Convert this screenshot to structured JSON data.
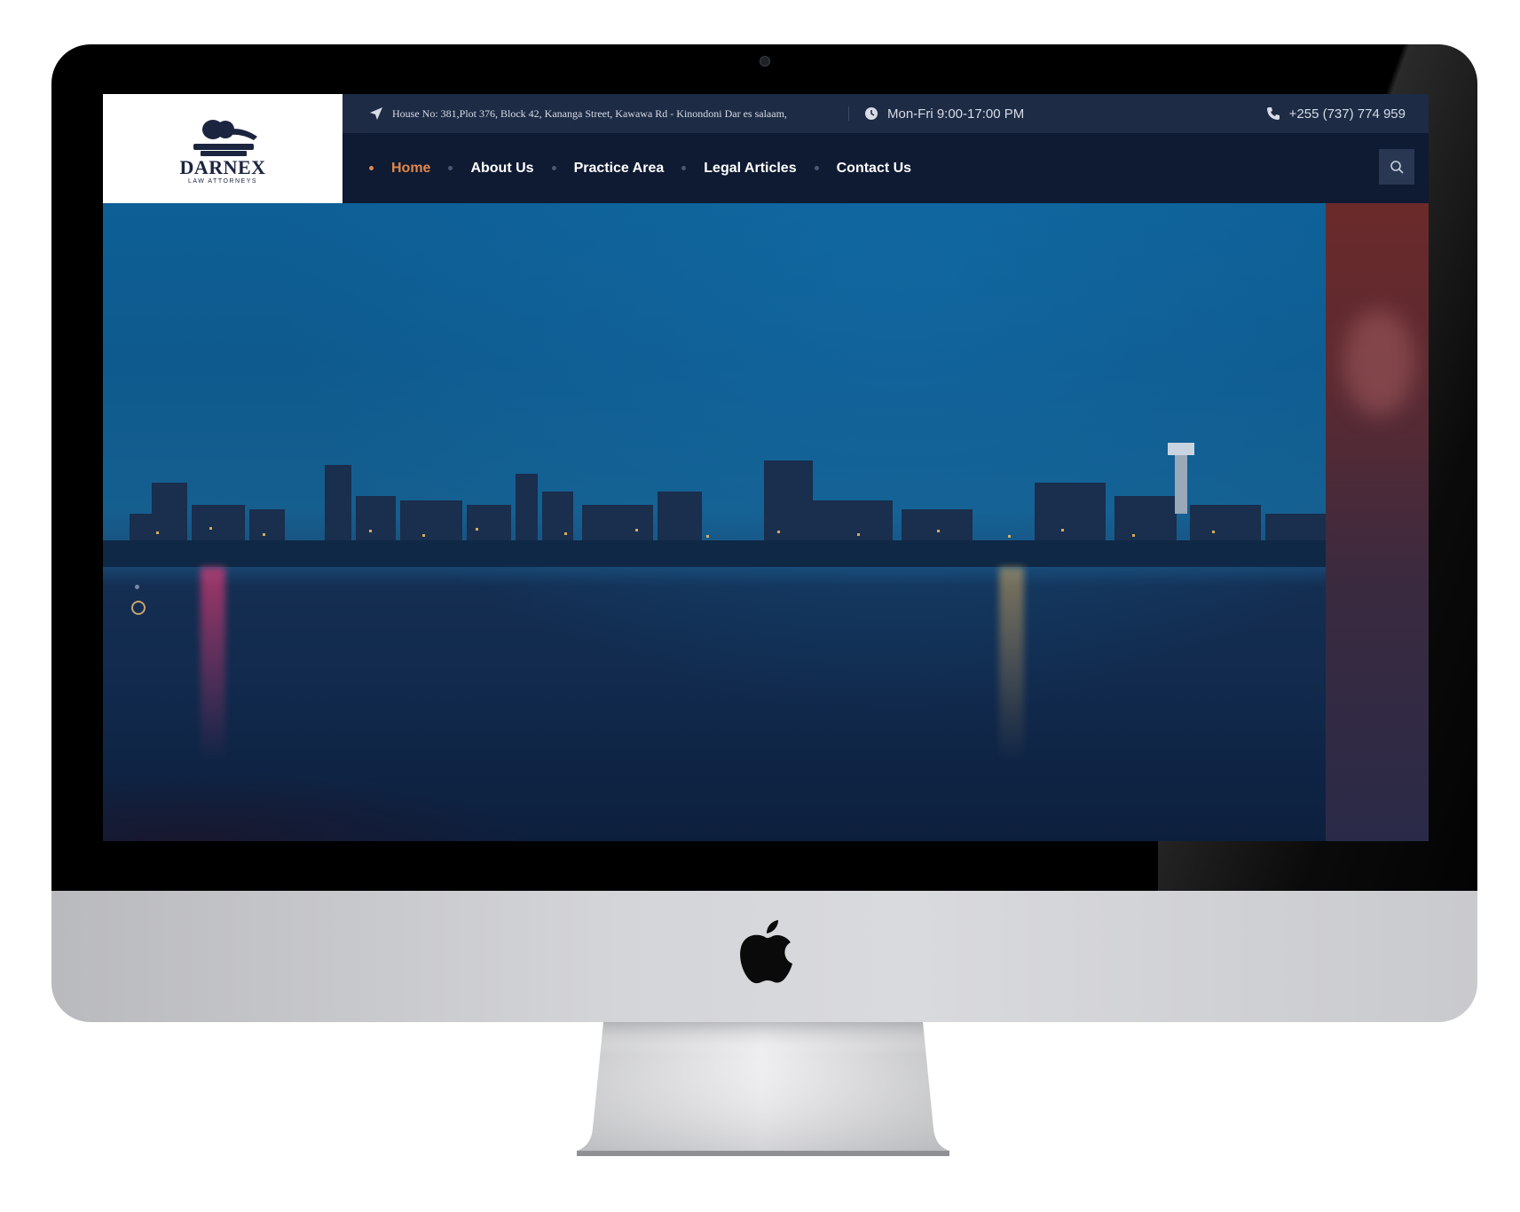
{
  "brand": {
    "name": "DARNEX",
    "tagline": "LAW ATTORNEYS",
    "accent_color": "#e0874a",
    "nav_bg": "#0f1a33",
    "topbar_bg": "#1d2b45"
  },
  "topbar": {
    "address": "House No: 381,Plot 376, Block 42, Kananga Street, Kawawa Rd - Kinondoni Dar es salaam,",
    "hours": "Mon-Fri 9:00-17:00 PM",
    "phone": "+255 (737) 774 959",
    "icons": [
      "location-arrow-icon",
      "clock-icon",
      "phone-icon"
    ]
  },
  "nav": {
    "items": [
      {
        "label": "Home",
        "active": true
      },
      {
        "label": "About Us",
        "active": false
      },
      {
        "label": "Practice Area",
        "active": false
      },
      {
        "label": "Legal Articles",
        "active": false
      },
      {
        "label": "Contact Us",
        "active": false
      }
    ],
    "search_icon": "search-icon"
  },
  "hero": {
    "slider_dots": 2,
    "active_slide": 2
  }
}
